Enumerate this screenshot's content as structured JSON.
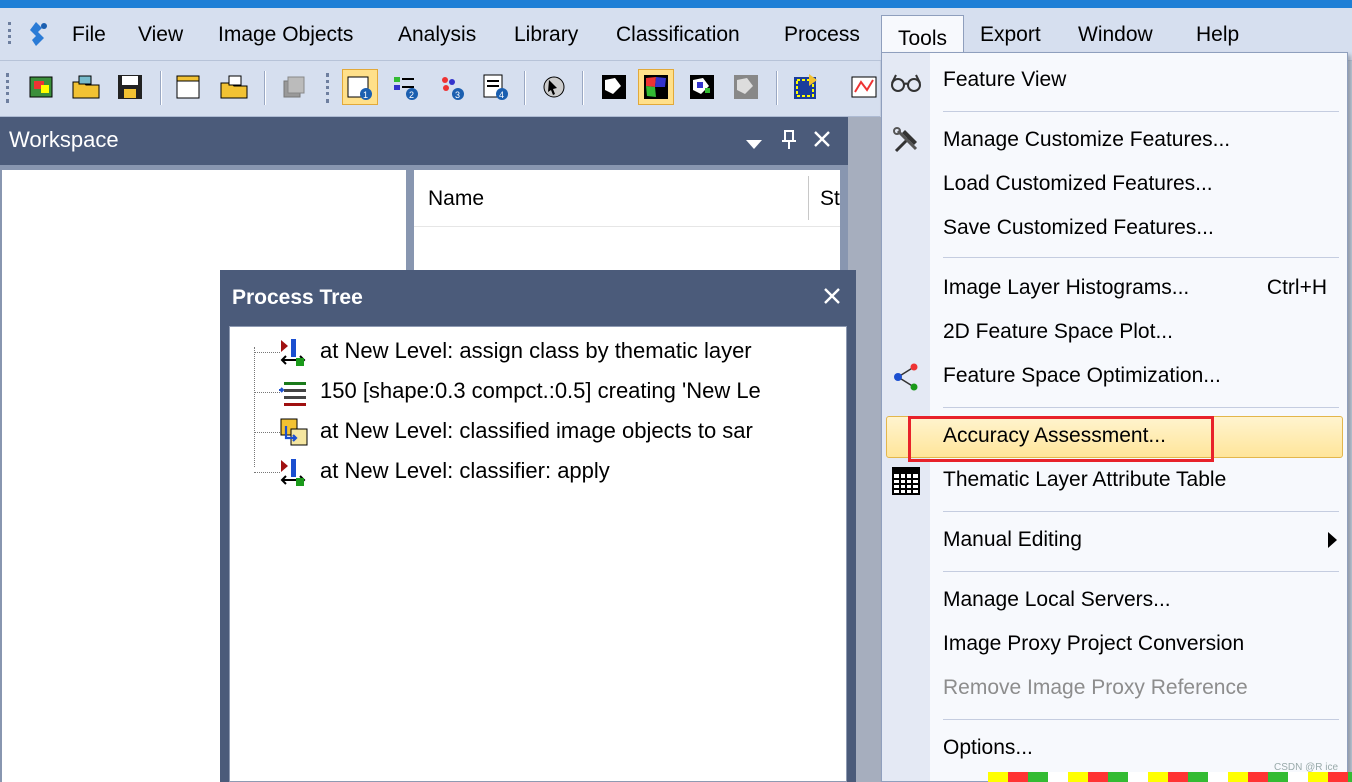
{
  "menubar": {
    "items": [
      "File",
      "View",
      "Image Objects",
      "Analysis",
      "Library",
      "Classification",
      "Process",
      "Tools",
      "Export",
      "Window",
      "Help"
    ]
  },
  "workspace": {
    "title": "Workspace",
    "columns": {
      "name": "Name",
      "status": "St"
    }
  },
  "process_tree": {
    "title": "Process Tree",
    "rows": [
      {
        "text": "at  New Level: assign class by thematic layer",
        "icon": "process-blue-arrow-icon"
      },
      {
        "text": "150 [shape:0.3 compct.:0.5] creating 'New Le",
        "icon": "segmentation-icon"
      },
      {
        "text": "at  New Level: classified image objects to sar",
        "icon": "export-objects-icon"
      },
      {
        "text": "at  New Level: classifier: apply",
        "icon": "process-blue-arrow-icon"
      }
    ]
  },
  "tools_menu": {
    "items": [
      {
        "label": "Feature View",
        "icon": "glasses-icon"
      },
      {
        "label": "Manage Customize Features...",
        "icon": "tools-hammer-icon"
      },
      {
        "label": "Load Customized Features..."
      },
      {
        "label": "Save Customized Features..."
      },
      {
        "label": "Image Layer Histograms...",
        "shortcut": "Ctrl+H"
      },
      {
        "label": "2D Feature Space Plot..."
      },
      {
        "label": "Feature Space Optimization...",
        "icon": "feature-optimization-icon"
      },
      {
        "label": "Accuracy Assessment...",
        "highlighted": true
      },
      {
        "label": "Thematic Layer Attribute Table",
        "icon": "table-grid-icon"
      },
      {
        "label": "Manual Editing",
        "submenu": true
      },
      {
        "label": "Manage Local Servers..."
      },
      {
        "label": "Image Proxy Project Conversion"
      },
      {
        "label": "Remove Image Proxy Reference",
        "disabled": true
      },
      {
        "label": "Options..."
      }
    ]
  },
  "watermark": "CSDN @R ice",
  "colors": {
    "menubar_bg": "#d6dfef",
    "panel_header": "#4b5b7a",
    "highlight": "#ffe59a",
    "red_annotation": "#e8222a"
  }
}
